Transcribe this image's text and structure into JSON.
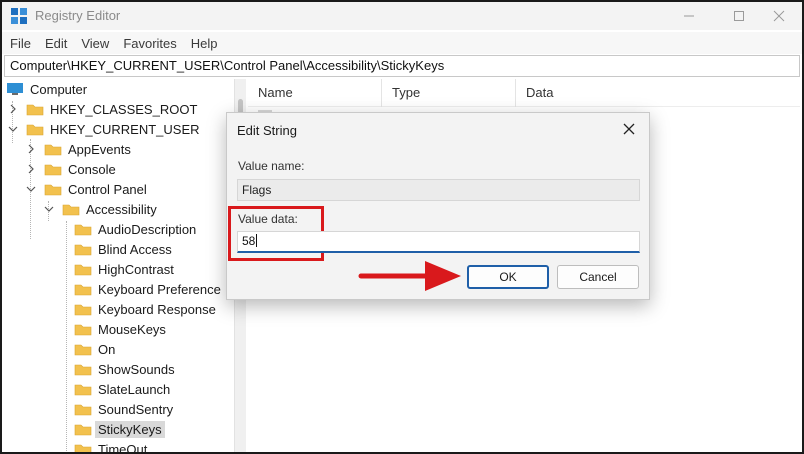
{
  "window": {
    "title": "Registry Editor"
  },
  "menu": [
    "File",
    "Edit",
    "View",
    "Favorites",
    "Help"
  ],
  "address": "Computer\\HKEY_CURRENT_USER\\Control Panel\\Accessibility\\StickyKeys",
  "tree": {
    "root": "Computer",
    "hkcr": "HKEY_CLASSES_ROOT",
    "hkcu": "HKEY_CURRENT_USER",
    "appevents": "AppEvents",
    "console": "Console",
    "control_panel": "Control Panel",
    "accessibility": "Accessibility",
    "children": [
      "AudioDescription",
      "Blind Access",
      "HighContrast",
      "Keyboard Preference",
      "Keyboard Response",
      "MouseKeys",
      "On",
      "ShowSounds",
      "SlateLaunch",
      "SoundSentry",
      "StickyKeys",
      "TimeOut"
    ],
    "selected": "StickyKeys"
  },
  "columns": {
    "name": "Name",
    "type": "Type",
    "data": "Data"
  },
  "dialog": {
    "title": "Edit String",
    "value_name_label": "Value name:",
    "value_name": "Flags",
    "value_data_label": "Value data:",
    "value_data": "58",
    "ok_label": "OK",
    "cancel_label": "Cancel"
  },
  "colors": {
    "highlight": "#d9191c",
    "focus": "#1f5fa8",
    "folder": "#f2c14e"
  },
  "icons": [
    "registry-app-icon",
    "minimize-icon",
    "maximize-icon",
    "close-icon",
    "chevron-right-icon",
    "chevron-down-icon",
    "folder-icon",
    "computer-icon",
    "arrow-annotation-icon"
  ]
}
